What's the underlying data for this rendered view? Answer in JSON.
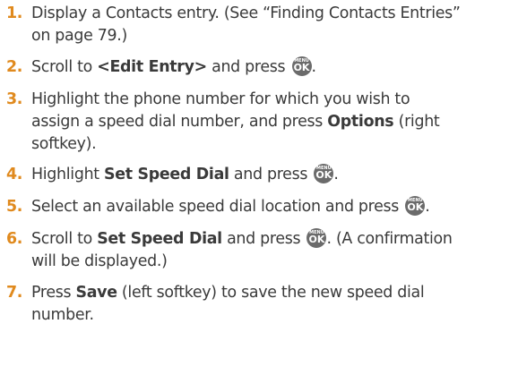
{
  "icon_name": "menu-ok-key-icon",
  "ok_key": {
    "top": "MENU",
    "bottom": "OK"
  },
  "steps": [
    {
      "number": "1.",
      "lines": [
        {
          "a": "Display a Contacts entry. (See “Finding Contacts Entries”"
        },
        {
          "a": "on page 79.)"
        }
      ]
    },
    {
      "number": "2.",
      "lines": [
        {
          "a": "Scroll to ",
          "b": "<Edit Entry>",
          "c": " and press "
        }
      ]
    },
    {
      "number": "3.",
      "lines": [
        {
          "a": "Highlight the phone number for which you wish to"
        },
        {
          "a": "assign a speed dial number, and press ",
          "b": "Options",
          "c": " (right"
        },
        {
          "a": "softkey)."
        }
      ]
    },
    {
      "number": "4.",
      "lines": [
        {
          "a": "Highlight ",
          "b": "Set Speed Dial",
          "c": " and press "
        }
      ]
    },
    {
      "number": "5.",
      "lines": [
        {
          "a": "Select an available speed dial location and press "
        }
      ]
    },
    {
      "number": "6.",
      "lines": [
        {
          "a": "Scroll to ",
          "b": "Set Speed Dial",
          "c": " and press ",
          "d": ". (A confirmation"
        },
        {
          "a": "will be displayed.)"
        }
      ]
    },
    {
      "number": "7.",
      "lines": [
        {
          "a": "Press ",
          "b": "Save",
          "c": " (left softkey) to save the new speed dial"
        },
        {
          "a": "number."
        }
      ]
    }
  ],
  "punct": {
    "period": "."
  }
}
